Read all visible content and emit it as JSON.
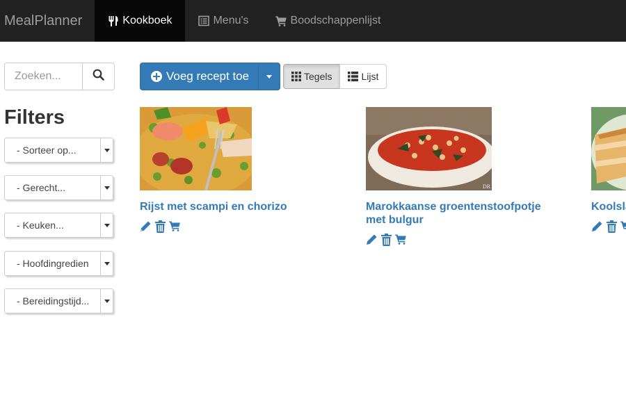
{
  "navbar": {
    "brand": "MealPlanner",
    "items": [
      {
        "label": "Kookboek",
        "icon": "cutlery-icon",
        "active": true
      },
      {
        "label": "Menu's",
        "icon": "list-alt-icon",
        "active": false
      },
      {
        "label": "Boodschappenlijst",
        "icon": "shopping-cart-icon",
        "active": false
      }
    ]
  },
  "sidebar": {
    "search_placeholder": "Zoeken...",
    "filters_title": "Filters",
    "filters": [
      {
        "label": "- Sorteer op..."
      },
      {
        "label": "- Gerecht..."
      },
      {
        "label": "- Keuken..."
      },
      {
        "label": "- Hoofdingredien"
      },
      {
        "label": "- Bereidingstijd..."
      }
    ]
  },
  "toolbar": {
    "add_label": "Voeg recept toe",
    "views": [
      {
        "label": "Tegels",
        "icon": "th-icon",
        "active": true
      },
      {
        "label": "Lijst",
        "icon": "th-list-icon",
        "active": false
      }
    ]
  },
  "recipes": [
    {
      "title": "Rijst met scampi en chorizo",
      "image": "paella-photo"
    },
    {
      "title": "Marokkaanse groentenstoofpotje met bulgur",
      "image": "stew-photo",
      "watermark": "DR"
    },
    {
      "title": "Koolsla",
      "image": "lasagna-photo"
    }
  ],
  "colors": {
    "navbar_bg": "#222222",
    "navbar_active": "#080808",
    "primary": "#337ab7",
    "link": "#337ab7"
  }
}
